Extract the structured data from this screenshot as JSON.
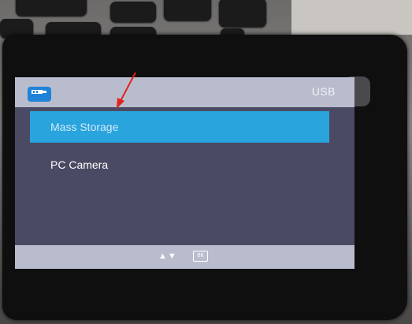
{
  "screen": {
    "title": "USB",
    "menu": [
      {
        "label": "Mass Storage",
        "selected": true
      },
      {
        "label": "PC Camera",
        "selected": false
      }
    ],
    "footer": {
      "nav_arrows": "▲▼",
      "ok_label": "OK"
    }
  },
  "colors": {
    "screen_bg": "#4b4a64",
    "bar_bg": "#b9bccd",
    "highlight": "#2aa4dd",
    "annotation_arrow": "#e0241b"
  },
  "icons": {
    "header": "usb-icon",
    "annotation": "red-arrow"
  }
}
